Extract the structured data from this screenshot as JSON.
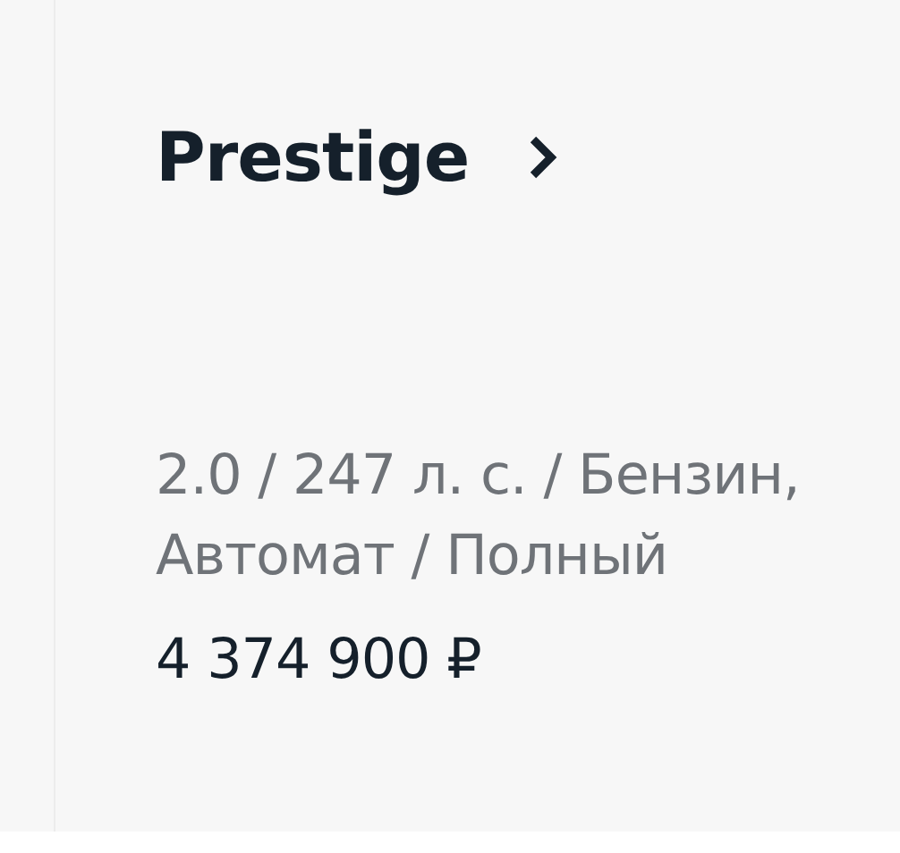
{
  "card": {
    "title": "Prestige",
    "specs": "2.0 / 247 л. с. / Бензин, Автомат / Полный",
    "price": "4 374 900 ₽"
  }
}
